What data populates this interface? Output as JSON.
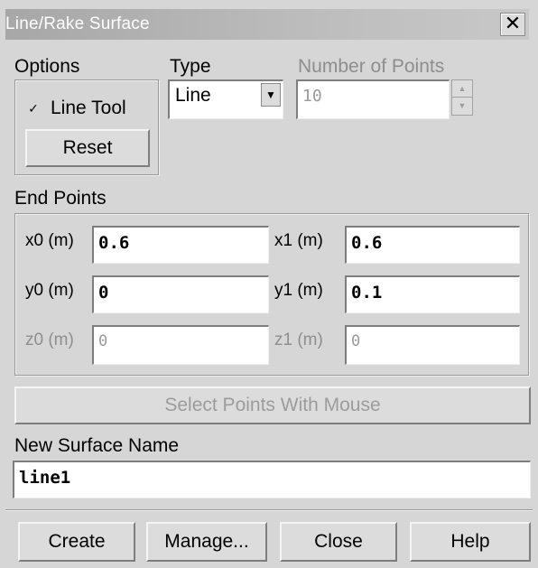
{
  "window": {
    "title": "Line/Rake Surface",
    "close_glyph": "✕"
  },
  "options": {
    "label": "Options",
    "line_tool": {
      "label": "Line Tool",
      "checked": true
    },
    "reset_label": "Reset"
  },
  "type": {
    "label": "Type",
    "selected": "Line"
  },
  "number_of_points": {
    "label": "Number of Points",
    "value": "10",
    "enabled": false
  },
  "end_points": {
    "label": "End Points",
    "x0": {
      "label": "x0 (m)",
      "value": "0.6"
    },
    "x1": {
      "label": "x1 (m)",
      "value": "0.6"
    },
    "y0": {
      "label": "y0 (m)",
      "value": "0"
    },
    "y1": {
      "label": "y1 (m)",
      "value": "0.1"
    },
    "z0": {
      "label": "z0 (m)",
      "value": "0",
      "enabled": false
    },
    "z1": {
      "label": "z1 (m)",
      "value": "0",
      "enabled": false
    }
  },
  "select_points_label": "Select Points With Mouse",
  "new_surface": {
    "label": "New Surface Name",
    "value": "line1"
  },
  "footer": {
    "create": "Create",
    "manage": "Manage...",
    "close": "Close",
    "help": "Help"
  }
}
